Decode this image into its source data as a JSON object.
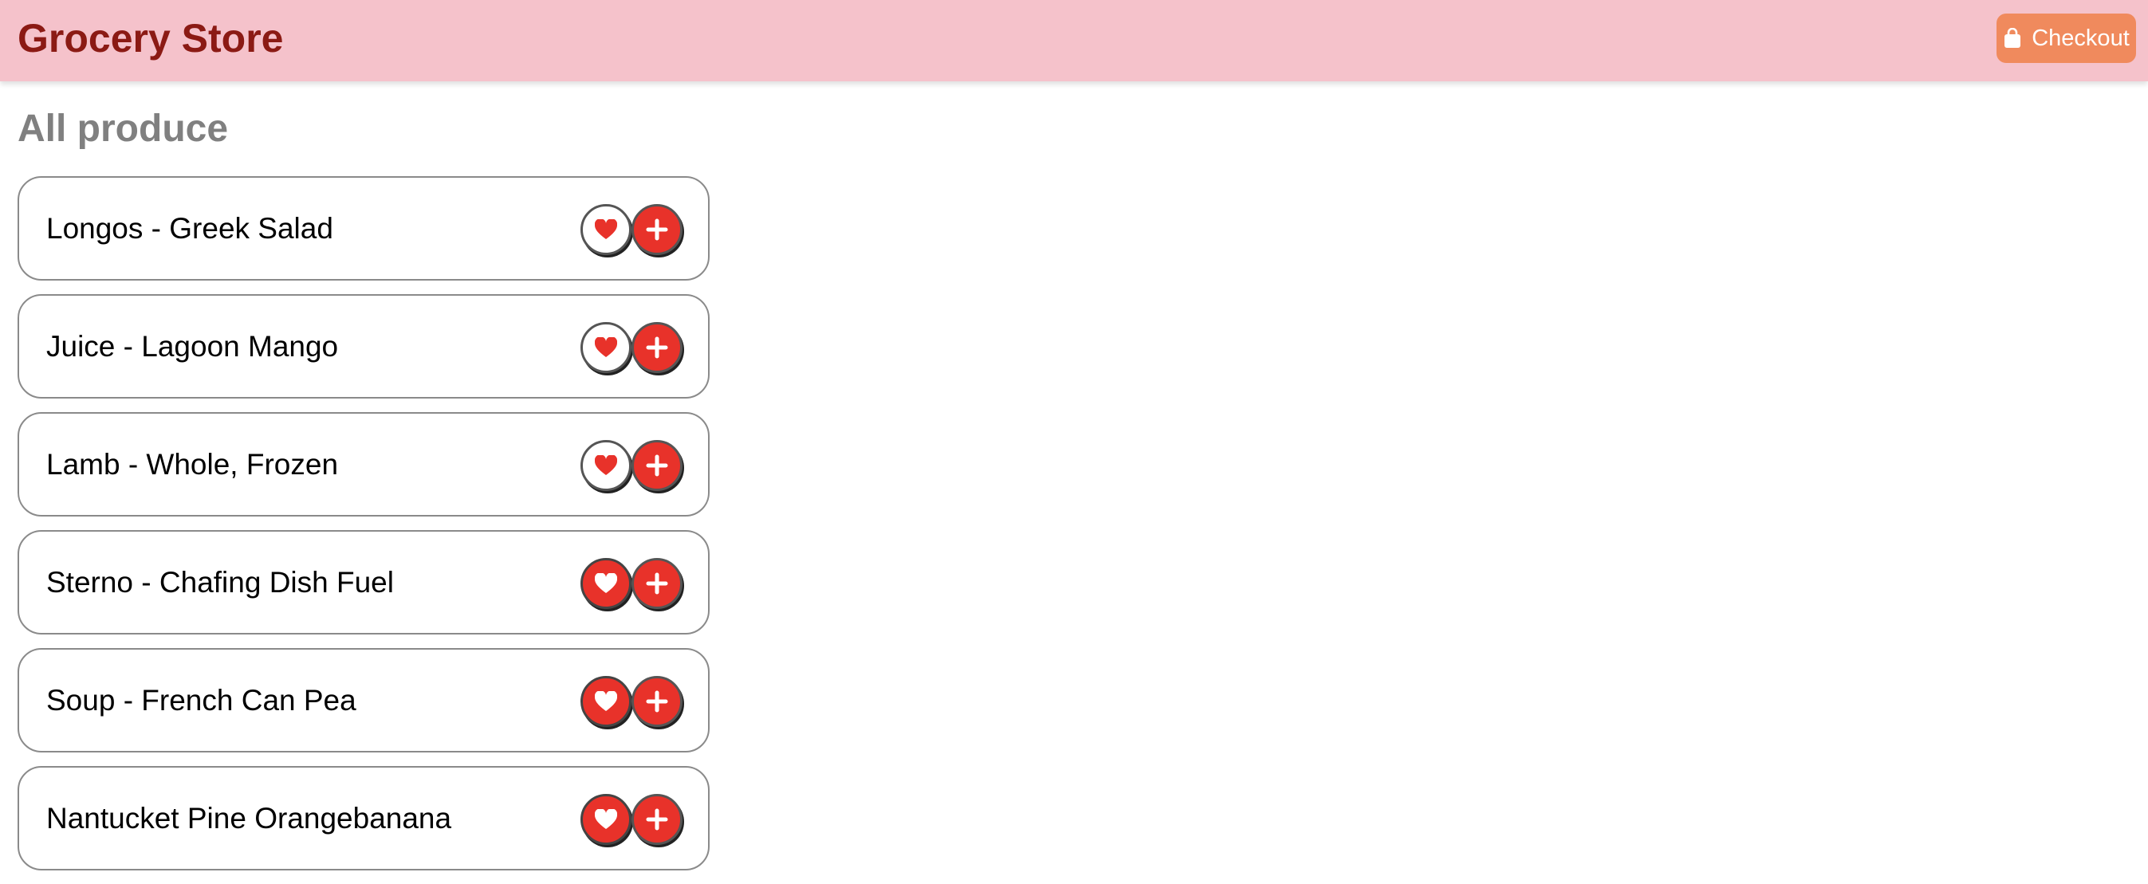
{
  "header": {
    "title": "Grocery Store",
    "checkout_label": "Checkout",
    "checkout_icon": "shopping-bag-icon"
  },
  "section": {
    "title": "All produce"
  },
  "products": [
    {
      "name": "Longos - Greek Salad",
      "favorited": false
    },
    {
      "name": "Juice - Lagoon Mango",
      "favorited": false
    },
    {
      "name": "Lamb - Whole, Frozen",
      "favorited": false
    },
    {
      "name": "Sterno - Chafing Dish Fuel",
      "favorited": true
    },
    {
      "name": "Soup - French Can Pea",
      "favorited": true
    },
    {
      "name": "Nantucket Pine Orangebanana",
      "favorited": true
    }
  ],
  "icons": {
    "favorite": "heart-icon",
    "add": "plus-icon"
  },
  "colors": {
    "header_bg": "#f5c2cb",
    "title": "#8b1a14",
    "checkout_bg": "#f08a5d",
    "accent_red": "#e8322a",
    "section_title": "#808080"
  }
}
